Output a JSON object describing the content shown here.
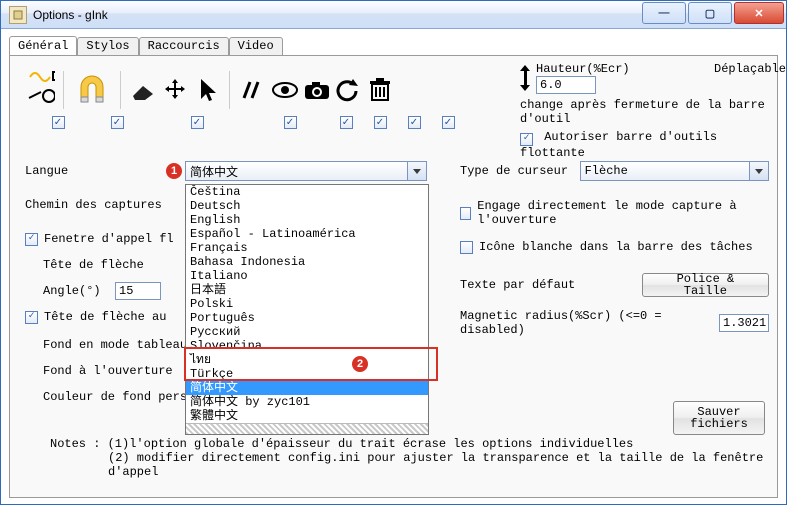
{
  "window": {
    "title": "Options - gInk"
  },
  "tabs": [
    "Général",
    "Stylos",
    "Raccourcis",
    "Video"
  ],
  "toolbar": {
    "checks": [
      true,
      true,
      true,
      true,
      true,
      true,
      true,
      true
    ]
  },
  "right_top": {
    "hauteur_label": "Hauteur(%Ecr)",
    "hauteur_value": "6.0",
    "deplacable": "Déplaçable",
    "change_text": "change après fermeture de la barre d'outil",
    "autoriser": "Autoriser barre d'outils flottante"
  },
  "left": {
    "langue_label": "Langue",
    "langue_value": "简体中文",
    "chemin_label": "Chemin des captures",
    "fenetre_label": "Fenetre d'appel fl",
    "tete_label": "Tête de flèche",
    "angle_label": "Angle(°)",
    "angle_value": "15",
    "tete2_label": "Tête de flèche au",
    "fond_tab_label": "Fond en mode tableau",
    "fond_ouv_label": "Fond à l'ouverture",
    "couleur_label": "Couleur de fond pers"
  },
  "dropdown": {
    "items": [
      "Čeština",
      "Deutsch",
      "English",
      "Español - Latinoamérica",
      "Français",
      "Bahasa Indonesia",
      "Italiano",
      "日本語",
      "Polski",
      "Português",
      "Русский",
      "Slovenčina",
      "ไทย",
      "Türkçe",
      "简体中文",
      "简体中文 by zyc101",
      "繁體中文"
    ],
    "selected_index": 14
  },
  "right": {
    "type_curseur_label": "Type de curseur",
    "type_curseur_value": "Flèche",
    "engage_label": "Engage directement le mode capture à l'ouverture",
    "icone_label": "Icône blanche dans la barre des tâches",
    "texte_defaut_label": "Texte par défaut",
    "police_btn": "Police & Taille",
    "magnetic_label": "Magnetic radius(%Scr) (<=0 = disabled)",
    "magnetic_value": "1.3021",
    "save_btn": "Sauver\nfichiers"
  },
  "notes": {
    "l1": "Notes : (1)l'option globale d'épaisseur du trait écrase les options individuelles",
    "l2": "(2) modifier directement config.ini pour ajuster la transparence et la taille de la fenêtre d'appel"
  },
  "badges": {
    "b1": "1",
    "b2": "2"
  }
}
